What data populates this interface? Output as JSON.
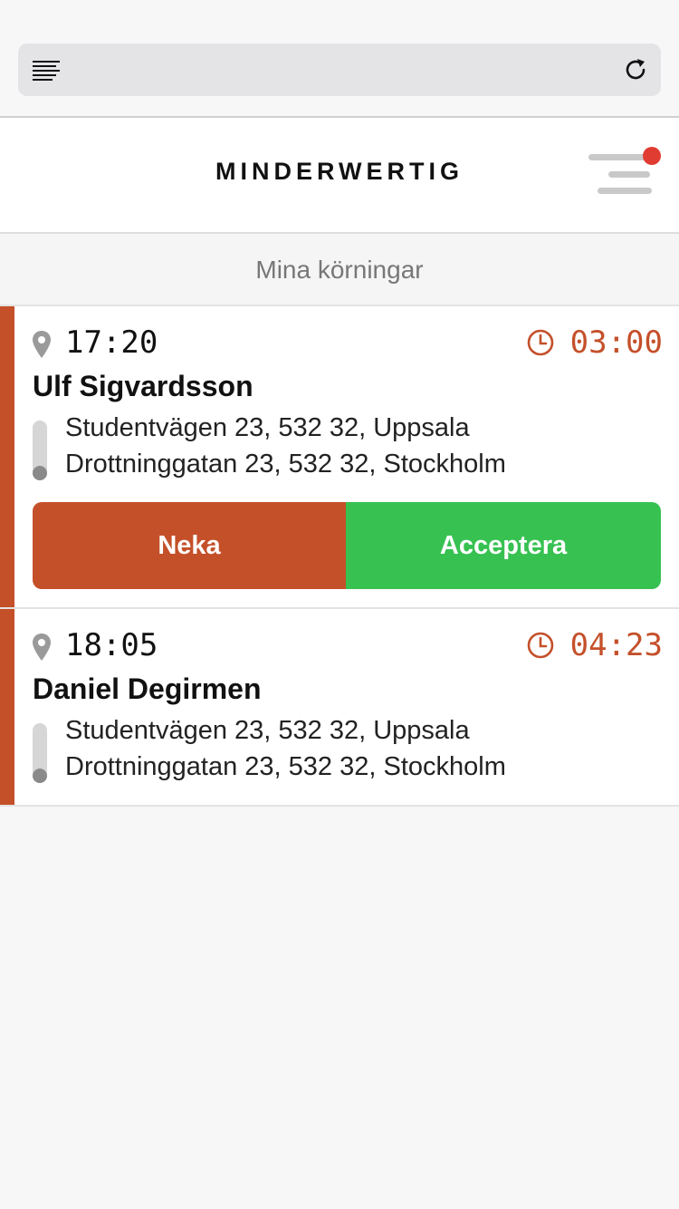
{
  "browser": {
    "reader_icon": "reader-view-icon",
    "reload_icon": "reload-icon"
  },
  "header": {
    "logo": "MINDERWERTIG",
    "menu_icon": "hamburger-menu-icon",
    "notification_dot_color": "#e03c31"
  },
  "section": {
    "title": "Mina körningar"
  },
  "colors": {
    "accent": "#c4502a",
    "accept": "#37c151"
  },
  "rides": [
    {
      "pickup_time": "17:20",
      "countdown": "03:00",
      "customer": "Ulf Sigvardsson",
      "from": "Studentvägen 23, 532 32, Uppsala",
      "to": "Drottninggatan 23, 532 32, Stockholm",
      "decline_label": "Neka",
      "accept_label": "Acceptera"
    },
    {
      "pickup_time": "18:05",
      "countdown": "04:23",
      "customer": "Daniel Degirmen",
      "from": "Studentvägen 23, 532 32, Uppsala",
      "to": "Drottninggatan 23, 532 32, Stockholm"
    }
  ]
}
